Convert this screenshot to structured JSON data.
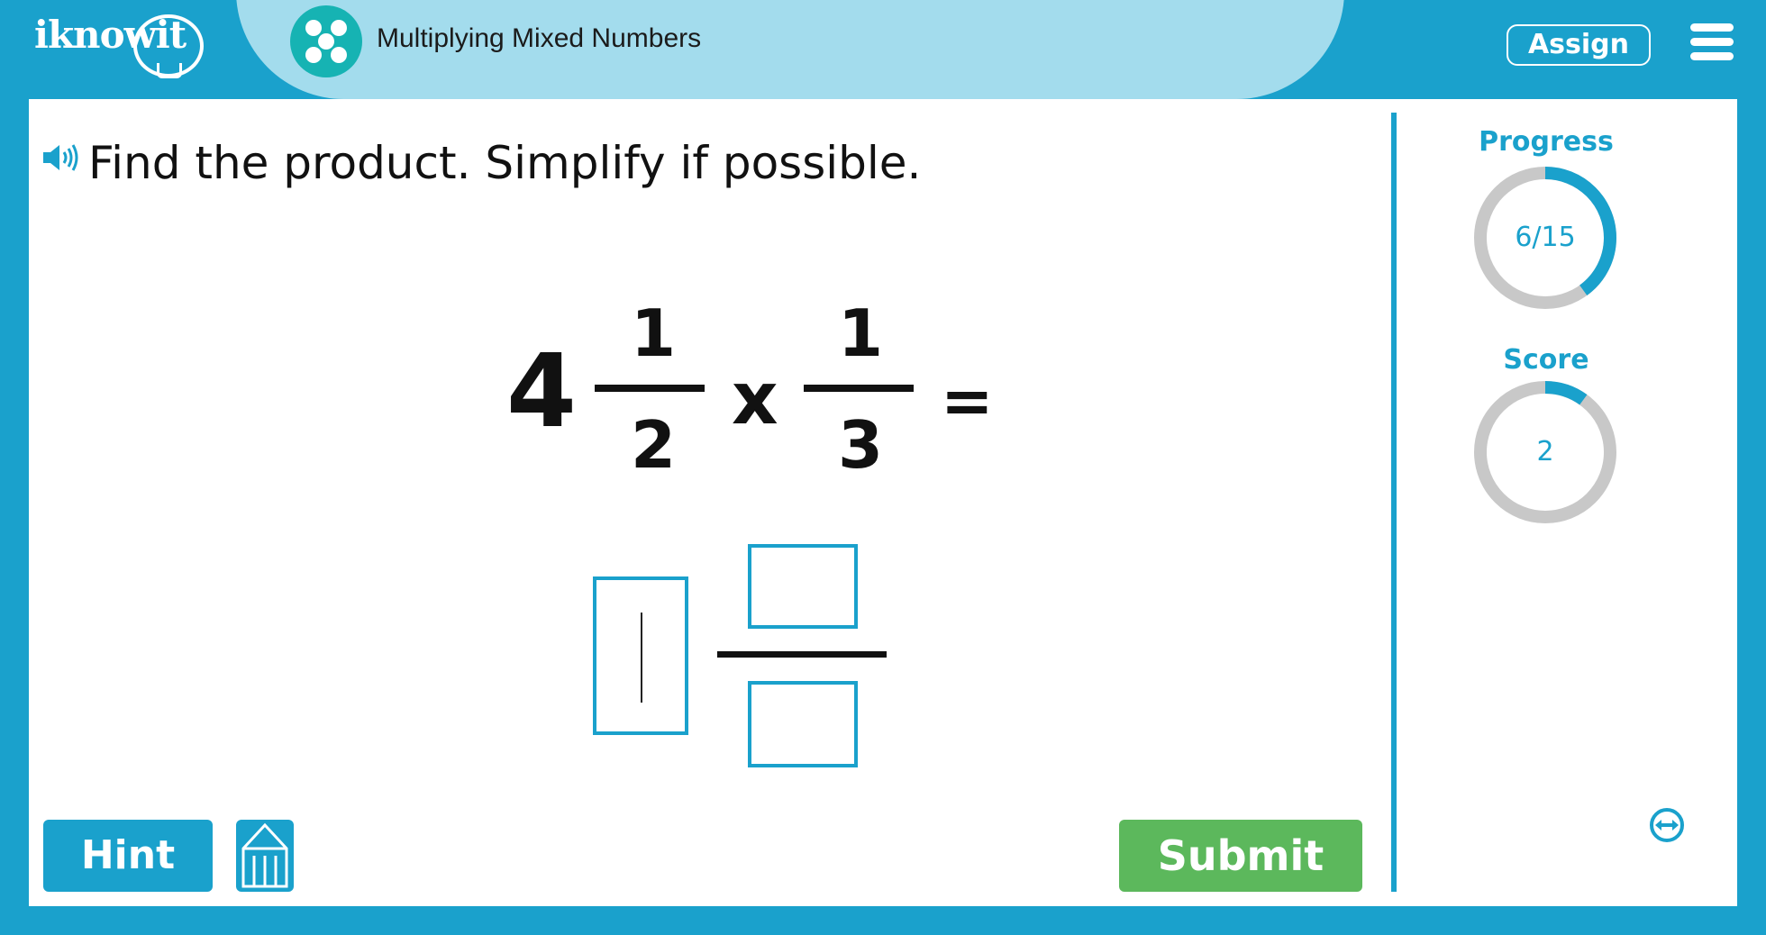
{
  "header": {
    "logo_text": "iknowit",
    "topic_title": "Multiplying Mixed Numbers",
    "assign_label": "Assign"
  },
  "question": {
    "prompt": "Find the product. Simplify if possible.",
    "whole": "4",
    "numerator1": "1",
    "denominator1": "2",
    "operator": "x",
    "numerator2": "1",
    "denominator2": "3",
    "equals": "="
  },
  "answer": {
    "whole_value": "",
    "numerator_value": "",
    "denominator_value": ""
  },
  "buttons": {
    "hint_label": "Hint",
    "submit_label": "Submit"
  },
  "sidebar": {
    "progress_label": "Progress",
    "progress_value": "6/15",
    "progress_fraction": 0.4,
    "score_label": "Score",
    "score_value": "2",
    "score_fraction": 0.1
  },
  "colors": {
    "accent": "#1aa1cc",
    "pill": "#a3dced",
    "topic_icon": "#16b3b3",
    "submit": "#5cb85c",
    "ring_track": "#c8c8c8"
  },
  "icons": [
    "speaker-icon",
    "menu-icon",
    "pencil-icon",
    "resize-arrows-icon",
    "topic-dice-icon",
    "lightbulb-logo-icon"
  ]
}
